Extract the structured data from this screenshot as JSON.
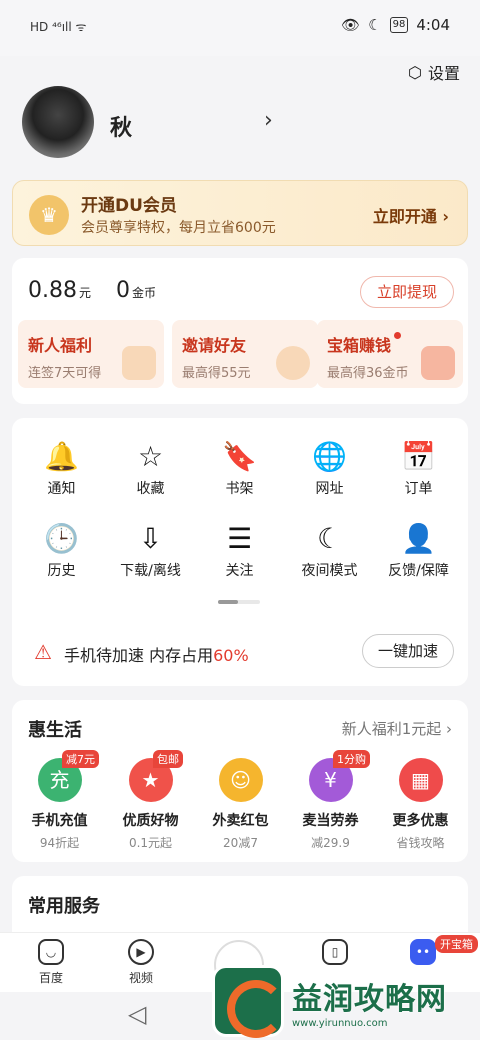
{
  "status": {
    "left": "HD ⁴⁶ıll ᯤ",
    "time": "4:04",
    "battery": "98"
  },
  "header": {
    "settings_label": "设置",
    "username": "秋"
  },
  "vip": {
    "title": "开通DU会员",
    "subtitle": "会员尊享特权，每月立省600元",
    "button": "立即开通 ›"
  },
  "wallet": {
    "balance": "0.88",
    "balance_unit": "元",
    "coins": "0",
    "coins_unit": "金币",
    "withdraw": "立即提现",
    "tiles": [
      {
        "title": "新人福利",
        "sub": "连签7天可得"
      },
      {
        "title": "邀请好友",
        "sub": "最高得55元"
      },
      {
        "title": "宝箱赚钱",
        "sub": "最高得36金币"
      }
    ]
  },
  "grid": {
    "items": [
      {
        "icon": "bell-icon",
        "glyph": "🔔",
        "label": "通知"
      },
      {
        "icon": "star-icon",
        "glyph": "☆",
        "label": "收藏"
      },
      {
        "icon": "bookshelf-icon",
        "glyph": "🔖",
        "label": "书架"
      },
      {
        "icon": "globe-icon",
        "glyph": "🌐",
        "label": "网址"
      },
      {
        "icon": "calendar-check-icon",
        "glyph": "📅",
        "label": "订单"
      },
      {
        "icon": "clock-icon",
        "glyph": "🕒",
        "label": "历史"
      },
      {
        "icon": "download-icon",
        "glyph": "⇩",
        "label": "下载/离线"
      },
      {
        "icon": "follow-icon",
        "glyph": "☰",
        "label": "关注"
      },
      {
        "icon": "moon-icon",
        "glyph": "☾",
        "label": "夜间模式"
      },
      {
        "icon": "feedback-shield-icon",
        "glyph": "👤",
        "label": "反馈/保障"
      }
    ]
  },
  "speed": {
    "text": "手机待加速 内存占用",
    "percent": "60%",
    "button": "一键加速"
  },
  "life": {
    "title": "惠生活",
    "more": "新人福利1元起 ›",
    "items": [
      {
        "name": "手机充值",
        "sub": "94折起",
        "tag": "减7元",
        "color": "#3cb371",
        "glyph": "充"
      },
      {
        "name": "优质好物",
        "sub": "0.1元起",
        "tag": "包邮",
        "color": "#f0524a",
        "glyph": "★"
      },
      {
        "name": "外卖红包",
        "sub": "20减7",
        "tag": "",
        "color": "#f5b52e",
        "glyph": "☺"
      },
      {
        "name": "麦当劳券",
        "sub": "减29.9",
        "tag": "1分购",
        "color": "#a35ad8",
        "glyph": "¥"
      },
      {
        "name": "更多优惠",
        "sub": "省钱攻略",
        "tag": "",
        "color": "#ef4b4b",
        "glyph": "▦"
      }
    ]
  },
  "services": {
    "title": "常用服务"
  },
  "tabbar": {
    "items": [
      {
        "label": "百度"
      },
      {
        "label": "视频"
      }
    ],
    "badge": "开宝箱"
  },
  "watermark": {
    "text": "益润攻略网",
    "url": "www.yirunnuo.com"
  }
}
